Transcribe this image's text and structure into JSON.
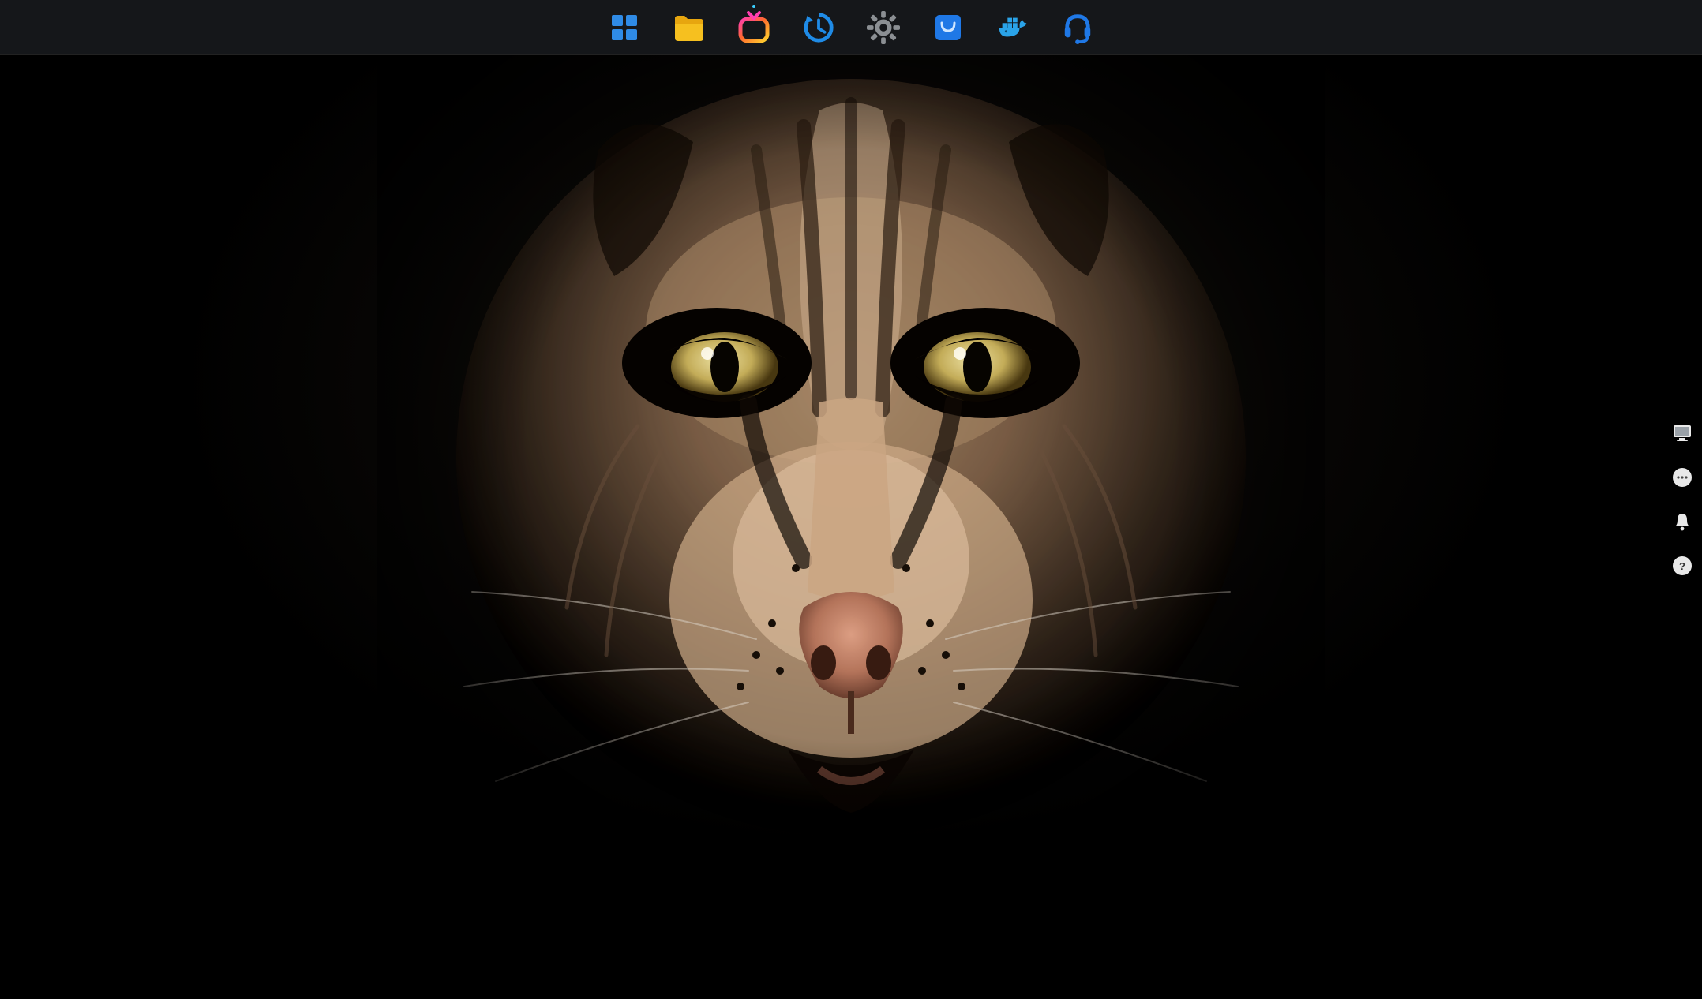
{
  "taskbar": {
    "items": [
      {
        "id": "apps",
        "icon": "grid-icon",
        "notify": false
      },
      {
        "id": "files",
        "icon": "folder-icon",
        "notify": false
      },
      {
        "id": "media",
        "icon": "tv-icon",
        "notify": true
      },
      {
        "id": "backup",
        "icon": "clock-icon",
        "notify": false
      },
      {
        "id": "settings",
        "icon": "gear-icon",
        "notify": false
      },
      {
        "id": "store",
        "icon": "bag-icon",
        "notify": false
      },
      {
        "id": "docker",
        "icon": "docker-icon",
        "notify": false
      },
      {
        "id": "support",
        "icon": "headset-icon",
        "notify": false
      }
    ]
  },
  "sidebar": {
    "items": [
      {
        "id": "pc",
        "icon": "monitor-icon"
      },
      {
        "id": "chat",
        "icon": "chat-icon"
      },
      {
        "id": "notify",
        "icon": "bell-icon"
      },
      {
        "id": "help",
        "icon": "help-icon"
      }
    ]
  },
  "wallpaper": {
    "subject": "wildcat-face",
    "subject_label": "Lynx / wildcat close-up on black"
  }
}
